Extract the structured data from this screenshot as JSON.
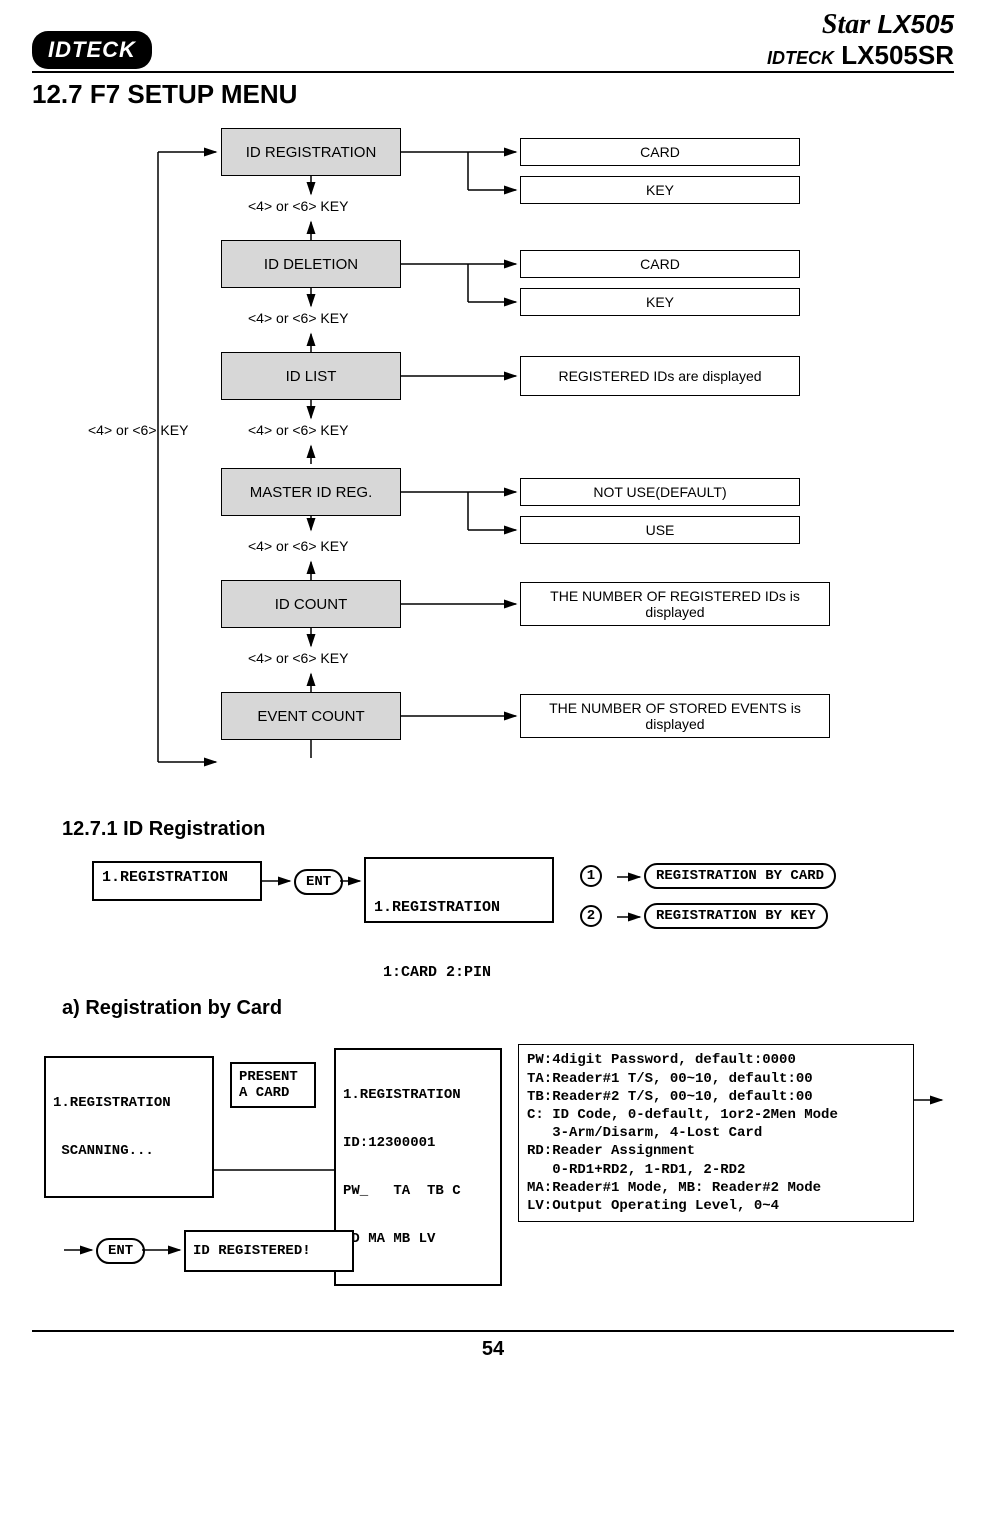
{
  "header": {
    "logo_left": "IDTECK",
    "logo_right_line1_a": "Star",
    "logo_right_line1_b": "LX505",
    "logo_right_line2_a": "IDTECK",
    "logo_right_line2_b": "LX505SR"
  },
  "section_title": "12.7 F7 SETUP MENU",
  "diagram": {
    "left_cycle_label": "<4> or <6> KEY",
    "key_label_1": "<4> or <6> KEY",
    "key_label_2": "<4> or <6> KEY",
    "key_label_3": "<4> or <6> KEY",
    "key_label_4": "<4> or <6> KEY",
    "key_label_5": "<4> or <6> KEY",
    "boxes": {
      "id_registration": "ID REGISTRATION",
      "id_deletion": "ID DELETION",
      "id_list": "ID LIST",
      "master_id_reg": "MASTER ID REG.",
      "id_count": "ID COUNT",
      "event_count": "EVENT COUNT"
    },
    "outputs": {
      "card1": "CARD",
      "key1": "KEY",
      "card2": "CARD",
      "key2": "KEY",
      "id_list_out": "REGISTERED IDs are displayed",
      "not_use": "NOT USE(DEFAULT)",
      "use": "USE",
      "id_count_out": "THE NUMBER OF REGISTERED IDs is displayed",
      "event_count_out": "THE NUMBER OF STORED EVENTS is displayed"
    }
  },
  "subsection_title": "12.7.1 ID Registration",
  "flow1": {
    "lcd1": "1.REGISTRATION",
    "ent": "ENT",
    "lcd2_l1": "1.REGISTRATION",
    "lcd2_l2": " 1:CARD 2:PIN",
    "c1": "1",
    "c2": "2",
    "opt1": "REGISTRATION BY CARD",
    "opt2": "REGISTRATION BY KEY"
  },
  "subsection2_title": "a) Registration by Card",
  "flow2": {
    "lcd_scan_l1": "1.REGISTRATION",
    "lcd_scan_l2": " SCANNING...",
    "present": "PRESENT\nA CARD",
    "lcd_id_l1": "1.REGISTRATION",
    "lcd_id_l2": "ID:12300001",
    "lcd_id_l3": "PW_   TA  TB C",
    "lcd_id_l4": "RD MA MB LV",
    "info": "PW:4digit Password, default:0000\nTA:Reader#1 T/S, 00~10, default:00\nTB:Reader#2 T/S, 00~10, default:00\nC: ID Code, 0-default, 1or2-2Men Mode\n   3-Arm/Disarm, 4-Lost Card\nRD:Reader Assignment\n   0-RD1+RD2, 1-RD1, 2-RD2\nMA:Reader#1 Mode, MB: Reader#2 Mode\nLV:Output Operating Level, 0~4",
    "ent": "ENT",
    "id_registered": "ID REGISTERED!"
  },
  "page_number": "54"
}
